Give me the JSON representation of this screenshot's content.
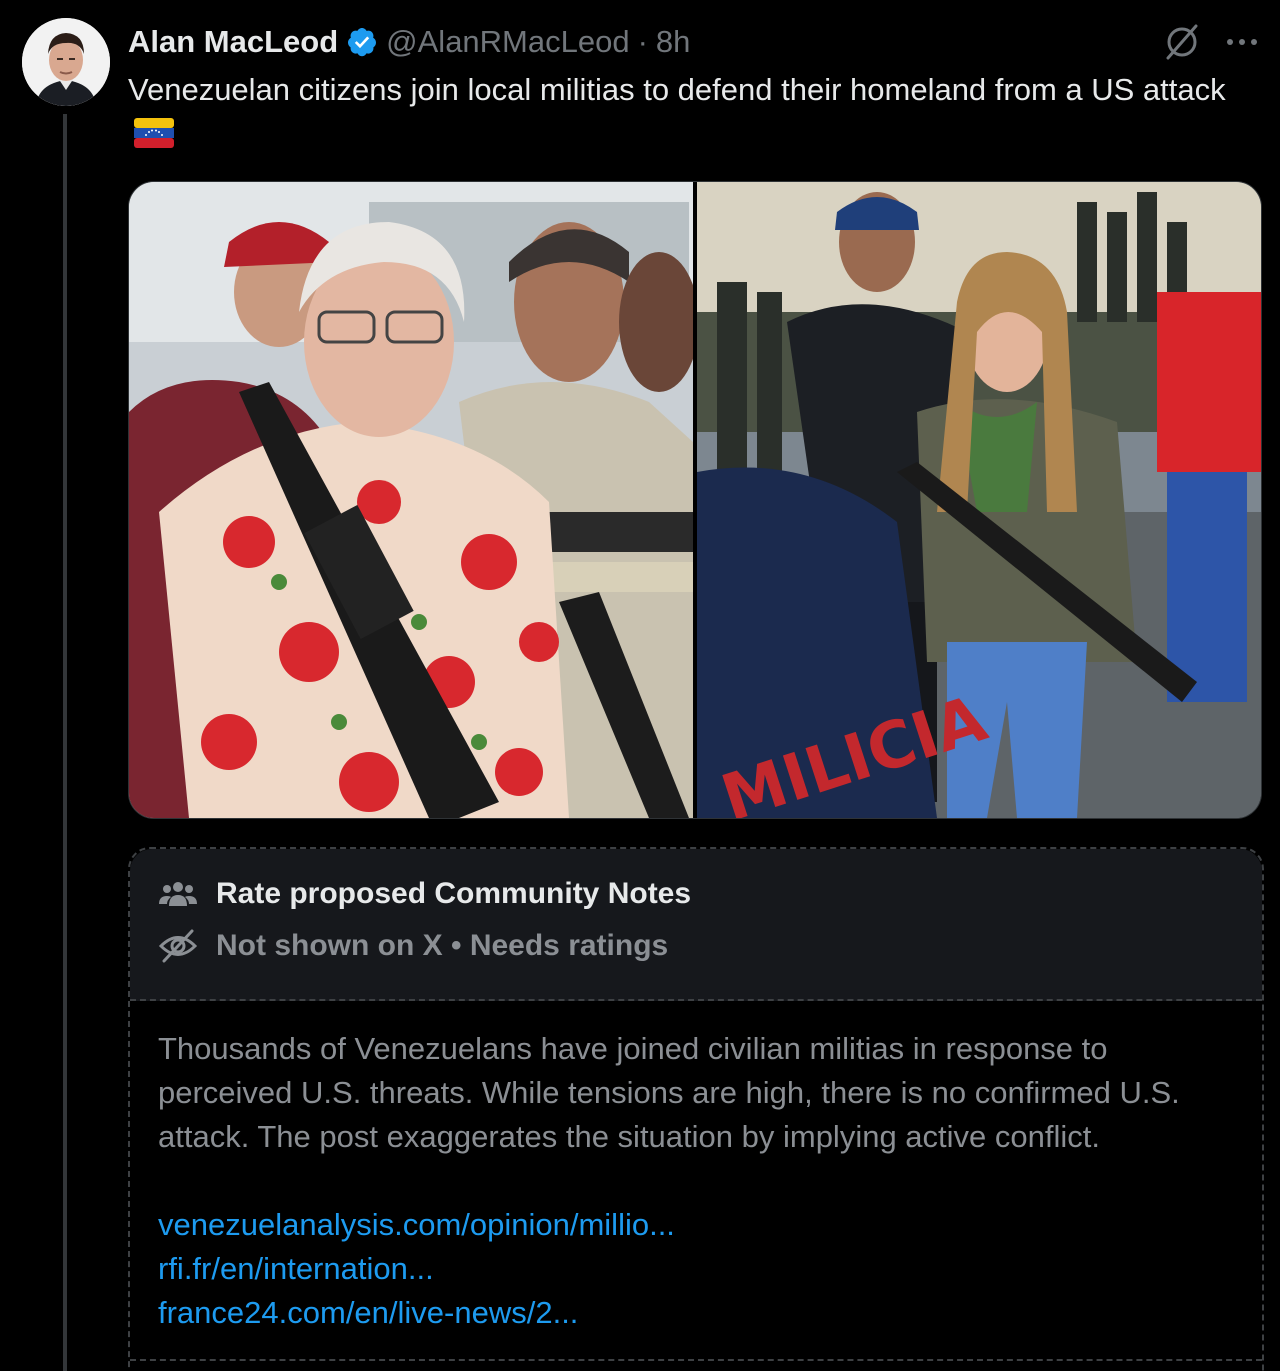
{
  "author": {
    "name": "Alan MacLeod",
    "handle": "@AlanRMacLeod",
    "separator": "·",
    "time": "8h",
    "verified": true
  },
  "tweet": {
    "text": "Venezuelan citizens join local militias to defend their homeland from a US attack",
    "emoji": "venezuela-flag"
  },
  "media": {
    "photos": [
      {
        "alt_icon": "photo-elderly-woman-with-rifle"
      },
      {
        "alt_icon": "photo-young-woman-with-rifle",
        "visible_text": "MILICIA"
      }
    ]
  },
  "community_notes": {
    "title": "Rate proposed Community Notes",
    "status": "Not shown on X • Needs ratings",
    "body": "Thousands of Venezuelans have joined civilian militias in response to perceived U.S. threats. While tensions are high, there is no confirmed U.S. attack. The post exaggerates the situation by implying active conflict.",
    "links": [
      "venezuelanalysis.com/opinion/millio...",
      "rfi.fr/en/internation...",
      "france24.com/en/live-news/2..."
    ]
  },
  "colors": {
    "background": "#000000",
    "primary_text": "#e7e9ea",
    "secondary_text": "#71767b",
    "link": "#1d9bf0",
    "verified": "#1d9bf0",
    "note_header_bg": "#16181c"
  }
}
